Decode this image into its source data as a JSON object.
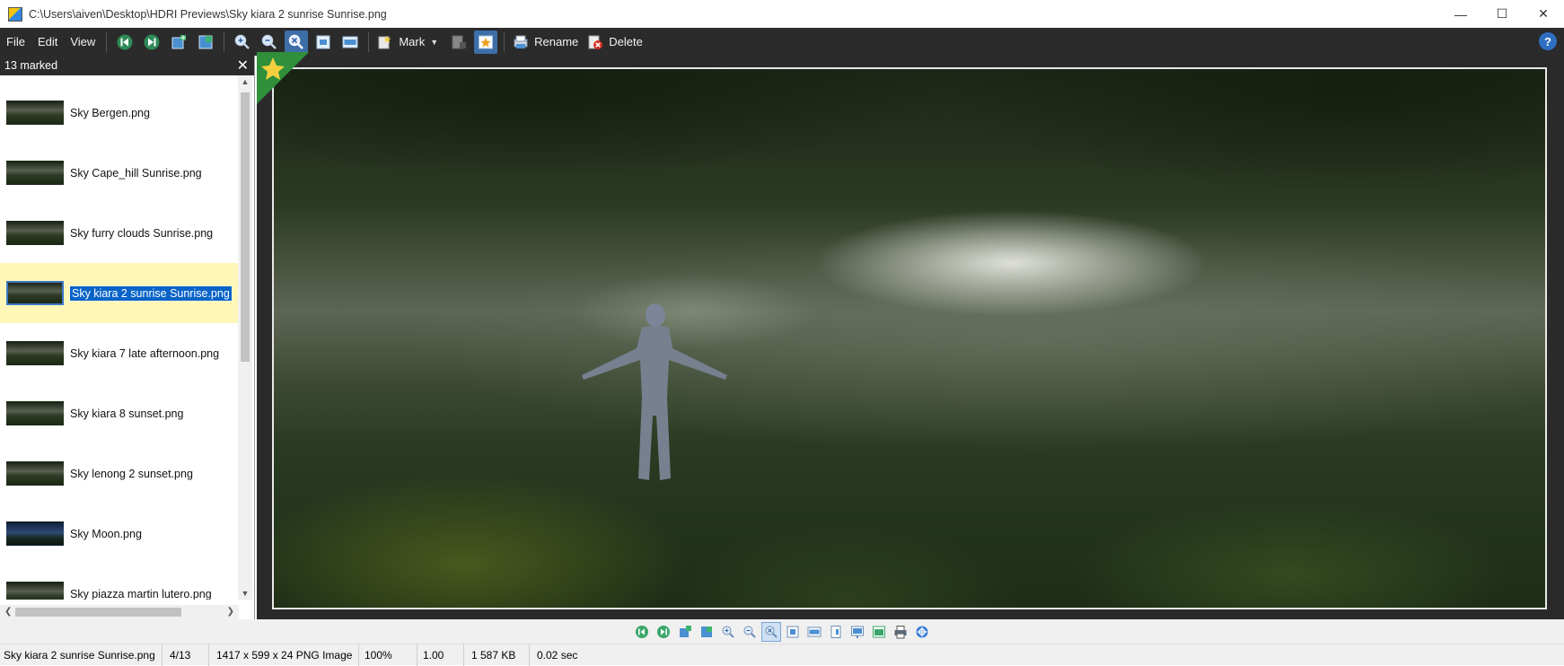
{
  "window": {
    "title": "C:\\Users\\aiven\\Desktop\\HDRI Previews\\Sky kiara 2 sunrise Sunrise.png",
    "controls": [
      "minimize",
      "maximize",
      "close"
    ]
  },
  "menu": {
    "file": "File",
    "edit": "Edit",
    "view": "View"
  },
  "toolbar": {
    "mark_label": "Mark",
    "rename_label": "Rename",
    "delete_label": "Delete",
    "help": "?"
  },
  "sidebar": {
    "header": "13 marked",
    "items": [
      {
        "label": "Sky Bergen.png",
        "selected": false
      },
      {
        "label": "Sky Cape_hill Sunrise.png",
        "selected": false
      },
      {
        "label": "Sky furry clouds Sunrise.png",
        "selected": false
      },
      {
        "label": "Sky kiara 2 sunrise Sunrise.png",
        "selected": true
      },
      {
        "label": "Sky kiara 7 late afternoon.png",
        "selected": false
      },
      {
        "label": "Sky kiara 8 sunset.png",
        "selected": false
      },
      {
        "label": "Sky lenong 2 sunset.png",
        "selected": false
      },
      {
        "label": "Sky Moon.png",
        "selected": false
      },
      {
        "label": "Sky piazza martin lutero.png",
        "selected": false
      }
    ]
  },
  "status": {
    "filename": "Sky kiara 2 sunrise Sunrise.png",
    "position": "4/13",
    "info": "1417 x 599 x 24 PNG Image",
    "zoom": "100%",
    "ratio": "1.00",
    "size": "1 587 KB",
    "time": "0.02 sec"
  },
  "colors": {
    "toolbar_bg": "#2b2b2b",
    "selection": "#0a64c8",
    "selected_row": "#fff7b8",
    "mark_star": "#f4d03f"
  }
}
